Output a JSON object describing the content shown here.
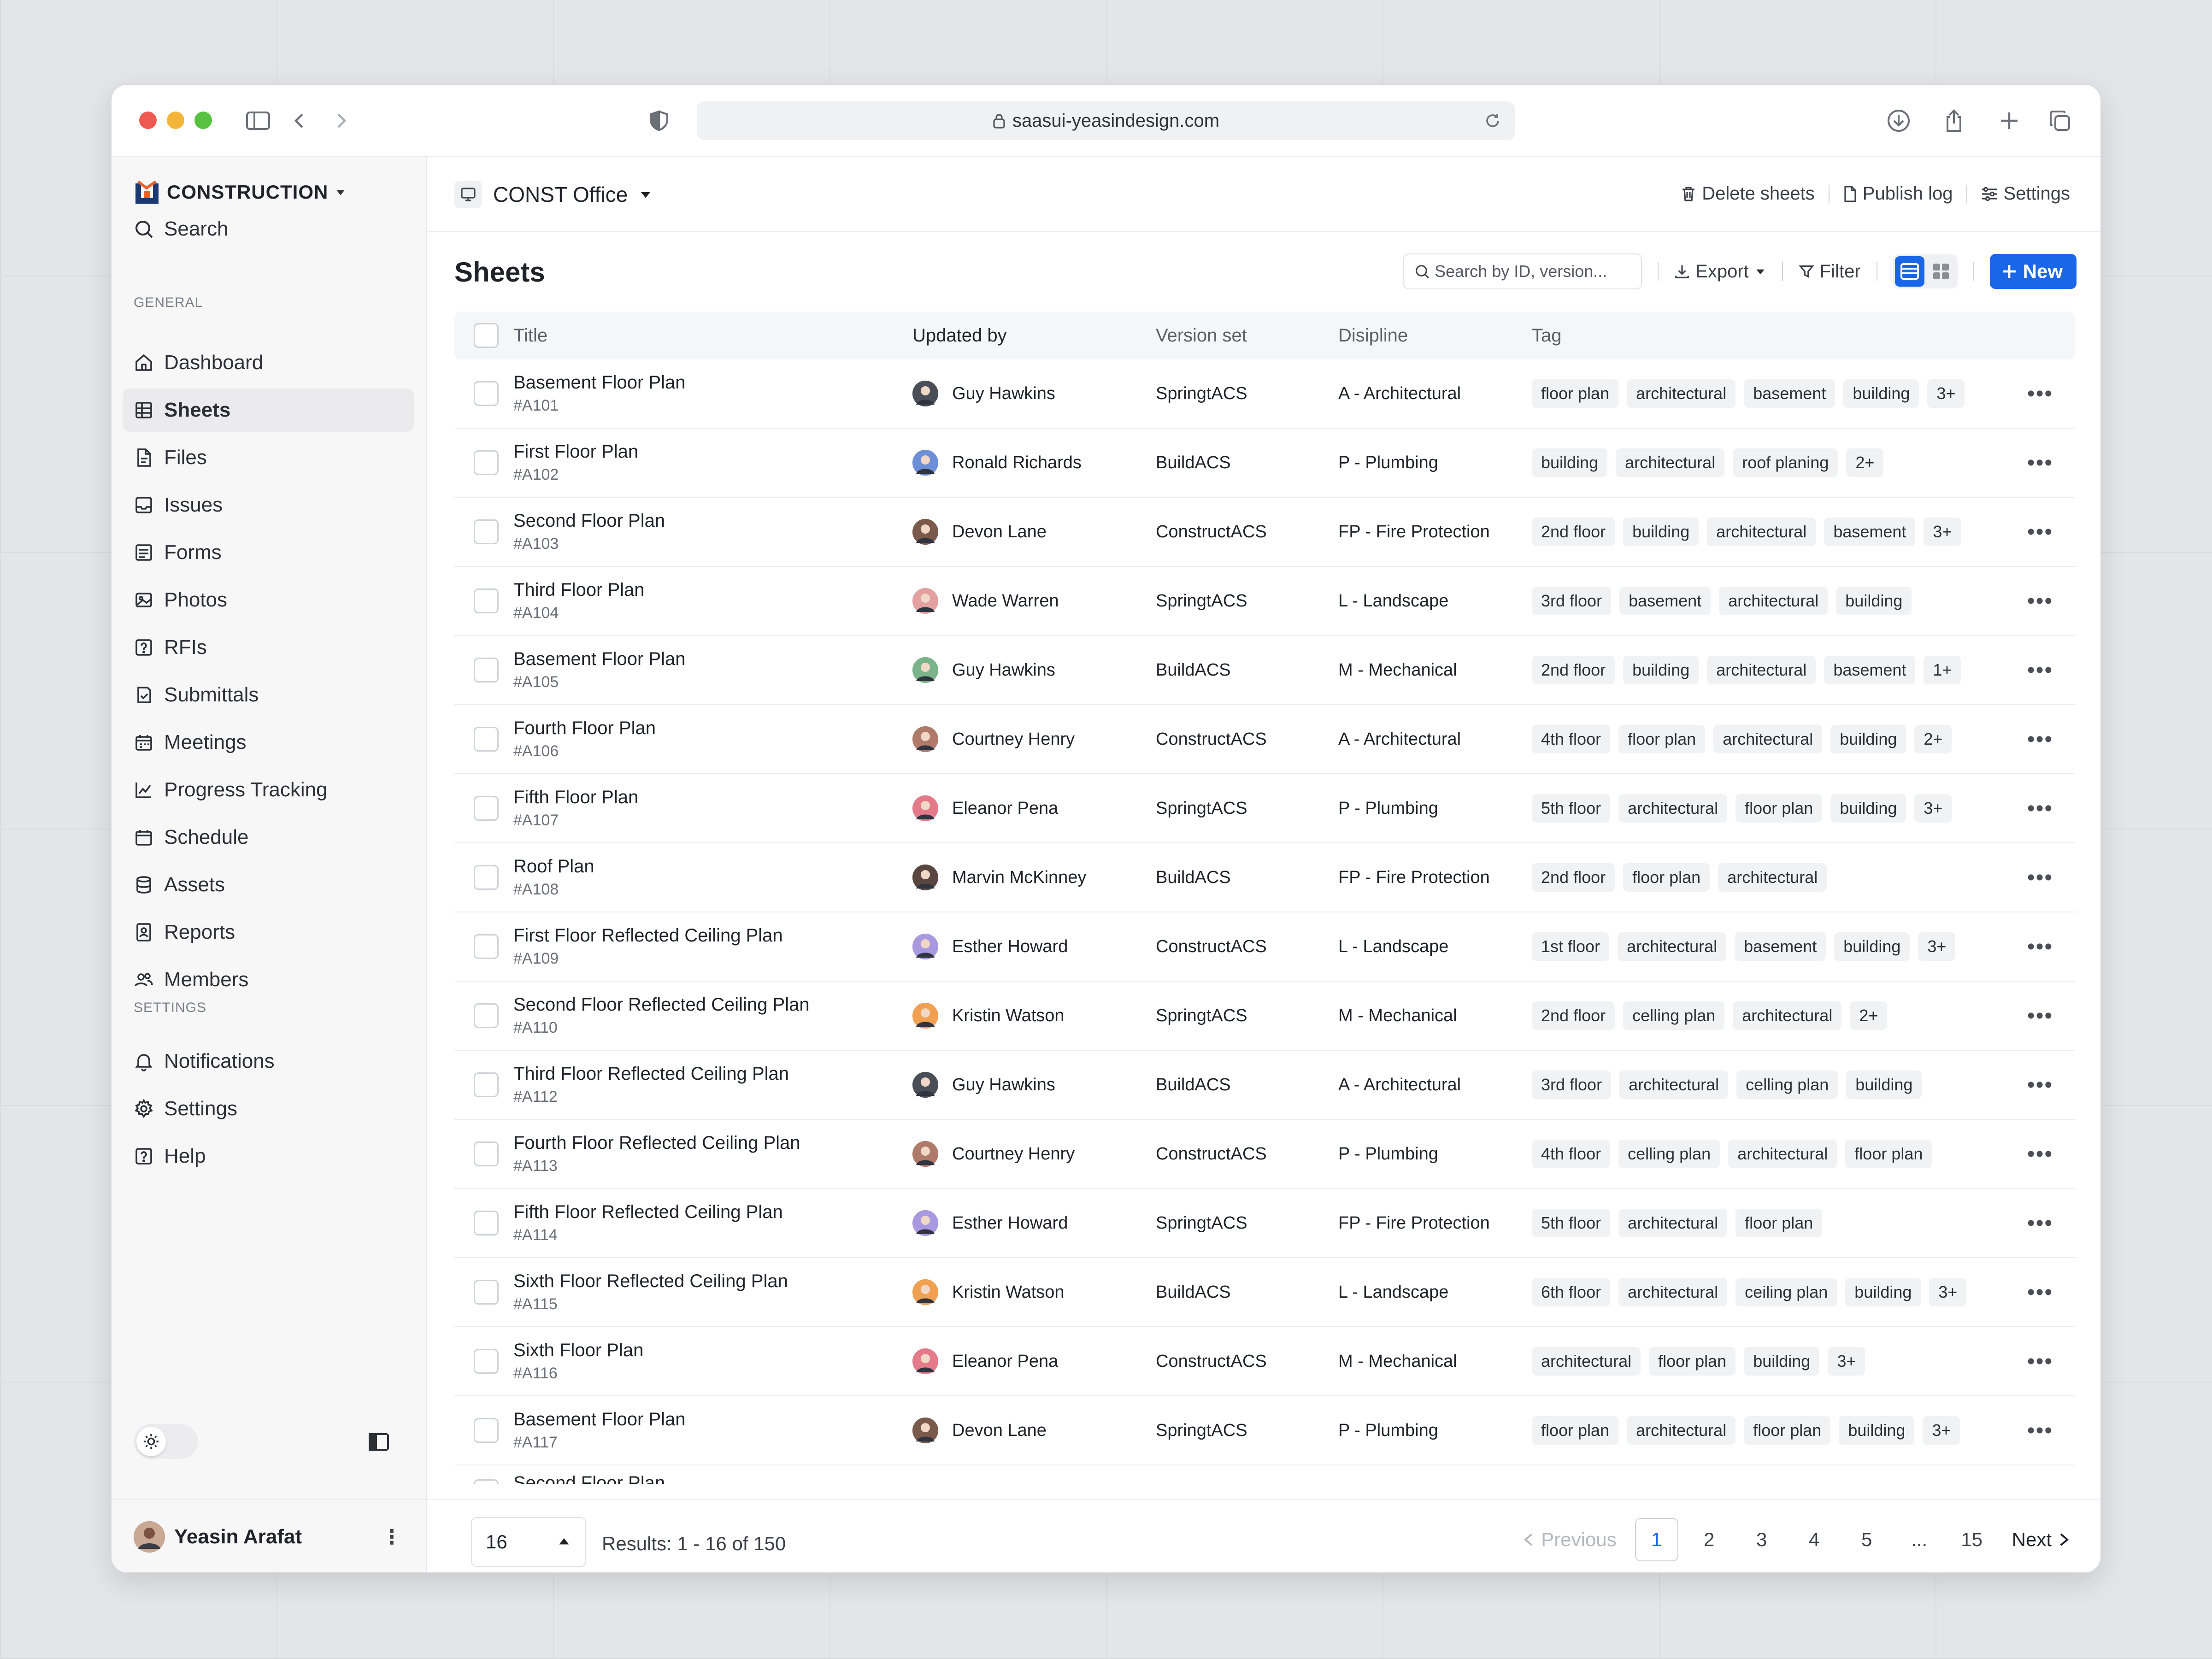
{
  "browser": {
    "url": "saasui-yeasindesign.com"
  },
  "colors": {
    "accent": "#1a66e8",
    "tl_red": "#ee5a52",
    "tl_yellow": "#f3b43a",
    "tl_green": "#57c23f"
  },
  "sidebar": {
    "brand": "CONSTRUCTION",
    "search": "Search",
    "general_label": "GENERAL",
    "items": [
      {
        "label": "Dashboard",
        "icon": "home-icon"
      },
      {
        "label": "Sheets",
        "icon": "grid-table-icon"
      },
      {
        "label": "Files",
        "icon": "file-icon"
      },
      {
        "label": "Issues",
        "icon": "inbox-icon"
      },
      {
        "label": "Forms",
        "icon": "form-icon"
      },
      {
        "label": "Photos",
        "icon": "photo-icon"
      },
      {
        "label": "RFIs",
        "icon": "question-icon"
      },
      {
        "label": "Submittals",
        "icon": "submit-icon"
      },
      {
        "label": "Meetings",
        "icon": "calendar-icon"
      },
      {
        "label": "Progress Tracking",
        "icon": "chart-icon"
      },
      {
        "label": "Schedule",
        "icon": "schedule-icon"
      },
      {
        "label": "Assets",
        "icon": "database-icon"
      },
      {
        "label": "Reports",
        "icon": "report-icon"
      },
      {
        "label": "Members",
        "icon": "users-icon"
      }
    ],
    "settings_label": "SETTINGS",
    "settings_items": [
      {
        "label": "Notifications",
        "icon": "bell-icon"
      },
      {
        "label": "Settings",
        "icon": "gear-icon"
      },
      {
        "label": "Help",
        "icon": "help-icon"
      }
    ],
    "user": "Yeasin Arafat"
  },
  "header": {
    "office": "CONST Office",
    "delete": "Delete sheets",
    "publish": "Publish log",
    "settings": "Settings"
  },
  "page": {
    "title": "Sheets",
    "search_placeholder": "Search by ID, version...",
    "export": "Export",
    "filter": "Filter",
    "new": "New"
  },
  "table": {
    "columns": [
      "Title",
      "Updated by",
      "Version set",
      "Disipline",
      "Tag"
    ],
    "rows": [
      {
        "title": "Basement Floor Plan",
        "id": "#A101",
        "user": "Guy Hawkins",
        "av": "#4a4f57",
        "version": "SpringtACS",
        "discipline": "A - Architectural",
        "tags": [
          "floor plan",
          "architectural",
          "basement",
          "building",
          "3+"
        ]
      },
      {
        "title": "First Floor Plan",
        "id": "#A102",
        "user": "Ronald Richards",
        "av": "#6d8fd8",
        "version": "BuildACS",
        "discipline": "P - Plumbing",
        "tags": [
          "building",
          "architectural",
          "roof planing",
          "2+"
        ]
      },
      {
        "title": "Second Floor Plan",
        "id": "#A103",
        "user": "Devon Lane",
        "av": "#7a5a4a",
        "version": "ConstructACS",
        "discipline": "FP - Fire Protection",
        "tags": [
          "2nd floor",
          "building",
          "architectural",
          "basement",
          "3+"
        ]
      },
      {
        "title": "Third Floor Plan",
        "id": "#A104",
        "user": "Wade Warren",
        "av": "#e2a0a0",
        "version": "SpringtACS",
        "discipline": "L - Landscape",
        "tags": [
          "3rd floor",
          "basement",
          "architectural",
          "building"
        ]
      },
      {
        "title": "Basement Floor Plan",
        "id": "#A105",
        "user": "Guy Hawkins",
        "av": "#7bb38a",
        "version": "BuildACS",
        "discipline": "M - Mechanical",
        "tags": [
          "2nd floor",
          "building",
          "architectural",
          "basement",
          "1+"
        ]
      },
      {
        "title": "Fourth Floor Plan",
        "id": "#A106",
        "user": "Courtney Henry",
        "av": "#b07a6a",
        "version": "ConstructACS",
        "discipline": "A - Architectural",
        "tags": [
          "4th floor",
          "floor plan",
          "architectural",
          "building",
          "2+"
        ]
      },
      {
        "title": "Fifth Floor Plan",
        "id": "#A107",
        "user": "Eleanor Pena",
        "av": "#e57b8a",
        "version": "SpringtACS",
        "discipline": "P - Plumbing",
        "tags": [
          "5th floor",
          "architectural",
          "floor plan",
          "building",
          "3+"
        ]
      },
      {
        "title": "Roof Plan",
        "id": "#A108",
        "user": "Marvin McKinney",
        "av": "#5a4640",
        "version": "BuildACS",
        "discipline": "FP - Fire Protection",
        "tags": [
          "2nd floor",
          "floor plan",
          "architectural"
        ]
      },
      {
        "title": "First Floor Reflected Ceiling Plan",
        "id": "#A109",
        "user": "Esther Howard",
        "av": "#a999e0",
        "version": "ConstructACS",
        "discipline": "L - Landscape",
        "tags": [
          "1st floor",
          "architectural",
          "basement",
          "building",
          "3+"
        ]
      },
      {
        "title": "Second Floor Reflected Ceiling Plan",
        "id": "#A110",
        "user": "Kristin Watson",
        "av": "#f0a050",
        "version": "SpringtACS",
        "discipline": "M - Mechanical",
        "tags": [
          "2nd floor",
          "celling plan",
          "architectural",
          "2+"
        ]
      },
      {
        "title": "Third Floor Reflected Ceiling Plan",
        "id": "#A112",
        "user": "Guy Hawkins",
        "av": "#4a4f57",
        "version": "BuildACS",
        "discipline": "A - Architectural",
        "tags": [
          "3rd floor",
          "architectural",
          "celling plan",
          "building"
        ]
      },
      {
        "title": "Fourth Floor Reflected Ceiling Plan",
        "id": "#A113",
        "user": "Courtney Henry",
        "av": "#b07a6a",
        "version": "ConstructACS",
        "discipline": "P - Plumbing",
        "tags": [
          "4th floor",
          "celling plan",
          "architectural",
          "floor plan"
        ]
      },
      {
        "title": "Fifth Floor Reflected Ceiling Plan",
        "id": "#A114",
        "user": "Esther Howard",
        "av": "#a999e0",
        "version": "SpringtACS",
        "discipline": "FP - Fire Protection",
        "tags": [
          "5th floor",
          "architectural",
          "floor plan"
        ]
      },
      {
        "title": "Sixth Floor Reflected Ceiling Plan",
        "id": "#A115",
        "user": "Kristin Watson",
        "av": "#f0a050",
        "version": "BuildACS",
        "discipline": "L - Landscape",
        "tags": [
          "6th floor",
          "architectural",
          "ceiling plan",
          "building",
          "3+"
        ]
      },
      {
        "title": "Sixth Floor Plan",
        "id": "#A116",
        "user": "Eleanor Pena",
        "av": "#e57b8a",
        "version": "ConstructACS",
        "discipline": "M - Mechanical",
        "tags": [
          "architectural",
          "floor plan",
          "building",
          "3+"
        ]
      },
      {
        "title": "Basement Floor Plan",
        "id": "#A117",
        "user": "Devon Lane",
        "av": "#7a5a4a",
        "version": "SpringtACS",
        "discipline": "P - Plumbing",
        "tags": [
          "floor plan",
          "architectural",
          "floor plan",
          "building",
          "3+"
        ]
      }
    ],
    "partial_row_title": "Second Floor Plan"
  },
  "footer": {
    "per_page": "16",
    "results": "Results: 1 - 16 of 150",
    "previous": "Previous",
    "pages": [
      "1",
      "2",
      "3",
      "4",
      "5",
      "...",
      "15"
    ],
    "current": "1",
    "next": "Next"
  }
}
